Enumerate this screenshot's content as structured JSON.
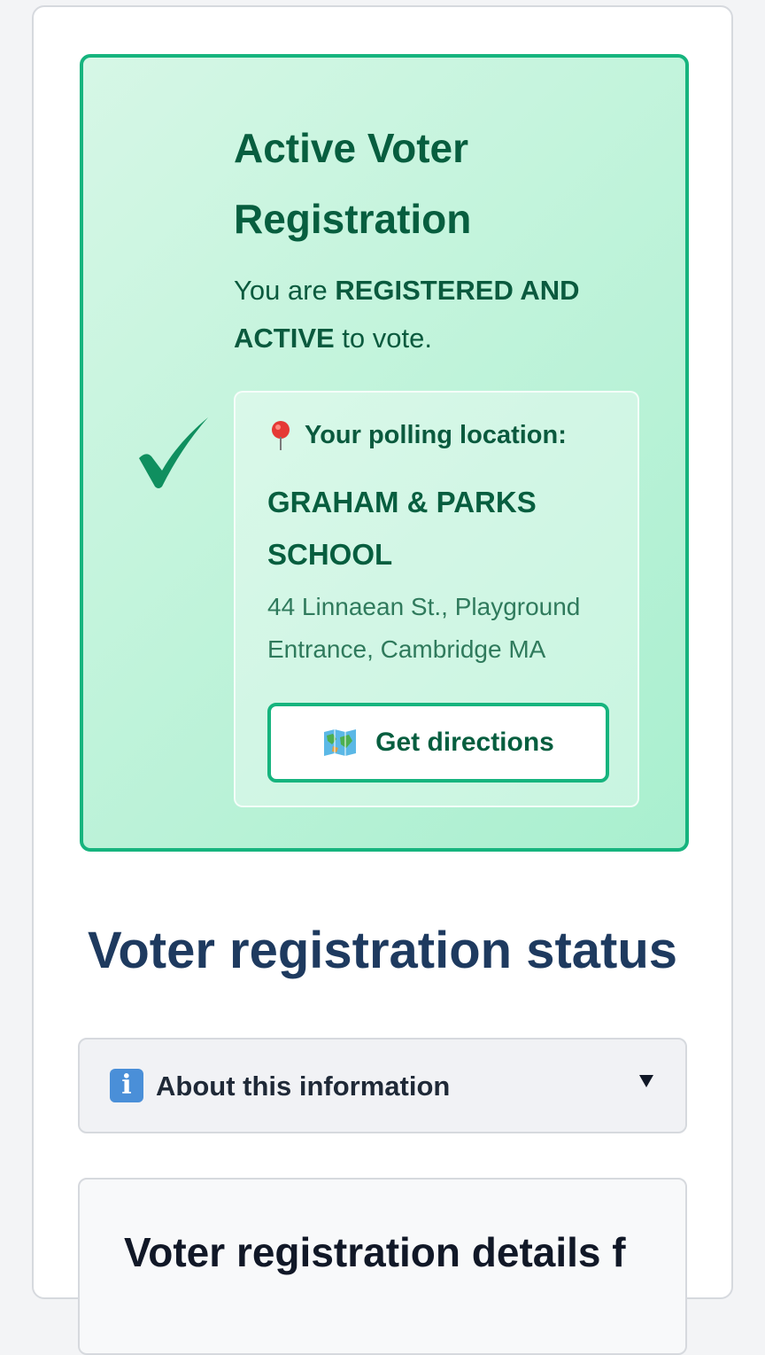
{
  "status": {
    "title": "Active Voter Registration",
    "text_prefix": "You are ",
    "text_emphasis": "REGISTERED AND ACTIVE",
    "text_suffix": " to vote.",
    "icon": "checkmark-icon",
    "accent_color": "#16b47e",
    "text_color": "#075e3f"
  },
  "polling": {
    "heading": "Your polling location:",
    "heading_icon": "map-pin-icon",
    "name": "GRAHAM & PARKS SCHOOL",
    "address": "44 Linnaean St., Playground Entrance, Cambridge MA",
    "directions_label": "Get directions",
    "directions_icon": "world-map-icon"
  },
  "section": {
    "title": "Voter registration status"
  },
  "about": {
    "label": "About this information",
    "icon": "info-icon",
    "expand_icon": "chevron-down-icon"
  },
  "details": {
    "title": "Voter registration details f"
  }
}
